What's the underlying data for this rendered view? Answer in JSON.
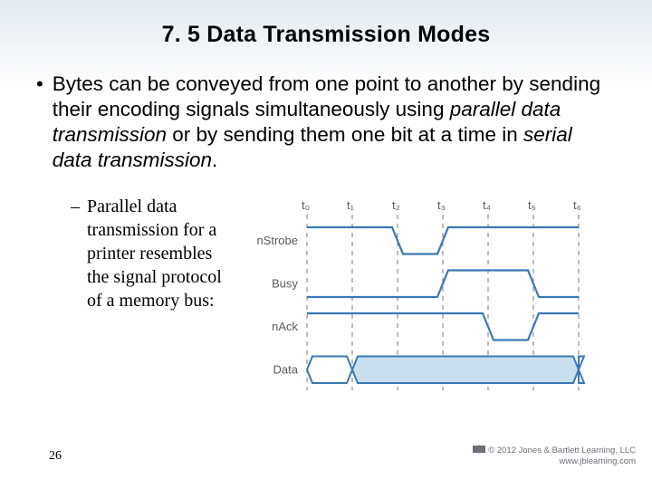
{
  "title": "7. 5 Data Transmission Modes",
  "bullet_pre": "Bytes can be conveyed from one point to another by sending their encoding signals simultaneously using ",
  "bullet_ital1": "parallel data transmission",
  "bullet_mid": " or by sending them one bit at a time in ",
  "bullet_ital2": "serial data transmission",
  "bullet_post": ".",
  "sub_bullet": "Parallel data transmission for a printer resembles the signal protocol of a memory bus:",
  "page_number": "26",
  "copyright_line1": "© 2012 Jones & Bartlett Learning, LLC",
  "copyright_line2": "www.jblearning.com",
  "chart_data": {
    "type": "timing-diagram",
    "time_labels": [
      "t₀",
      "t₁",
      "t₂",
      "t₃",
      "t₄",
      "t₅",
      "t₆"
    ],
    "signal_labels": [
      "nStrobe",
      "Busy",
      "nAck",
      "Data"
    ],
    "signals": {
      "nStrobe": {
        "initial": "high",
        "transitions": [
          {
            "at": 2,
            "to": "low"
          },
          {
            "at": 3,
            "to": "high"
          }
        ]
      },
      "Busy": {
        "initial": "low",
        "transitions": [
          {
            "at": 3,
            "to": "high"
          },
          {
            "at": 5,
            "to": "low"
          }
        ]
      },
      "nAck": {
        "initial": "high",
        "transitions": [
          {
            "at": 4,
            "to": "low"
          },
          {
            "at": 5,
            "to": "high"
          }
        ]
      },
      "Data": {
        "type": "bus",
        "valid_from": 1,
        "valid_to": 6
      }
    },
    "colors": {
      "signal": "#3a78b5",
      "grid": "#7a7a7a",
      "text": "#5a5a5a",
      "fill": "#c9dff0"
    }
  }
}
